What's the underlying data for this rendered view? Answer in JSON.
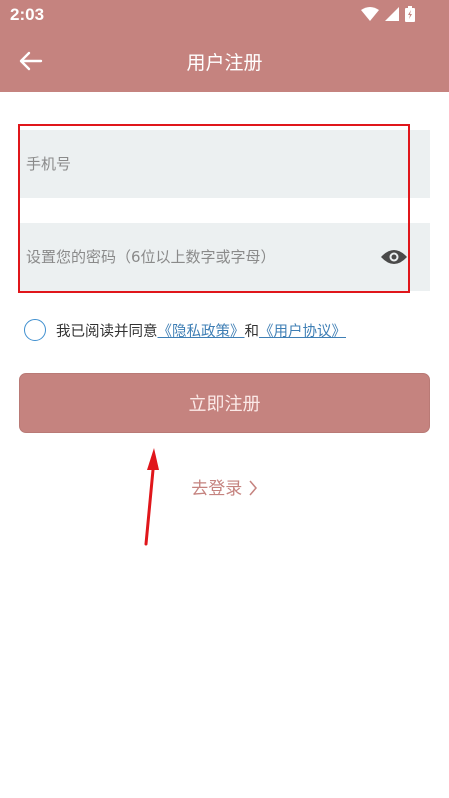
{
  "status_bar": {
    "time": "2:03"
  },
  "app_bar": {
    "title": "用户注册"
  },
  "form": {
    "phone_placeholder": "手机号",
    "password_placeholder": "设置您的密码（6位以上数字或字母）"
  },
  "agreement": {
    "prefix": "我已阅读并同意",
    "privacy_link": "《隐私政策》",
    "joiner": "和",
    "terms_link": "《用户协议》"
  },
  "register_button": "立即注册",
  "login_link": "去登录",
  "colors": {
    "primary": "#c5837f",
    "annotation": "#e0161b",
    "link": "#3f7fb5"
  }
}
